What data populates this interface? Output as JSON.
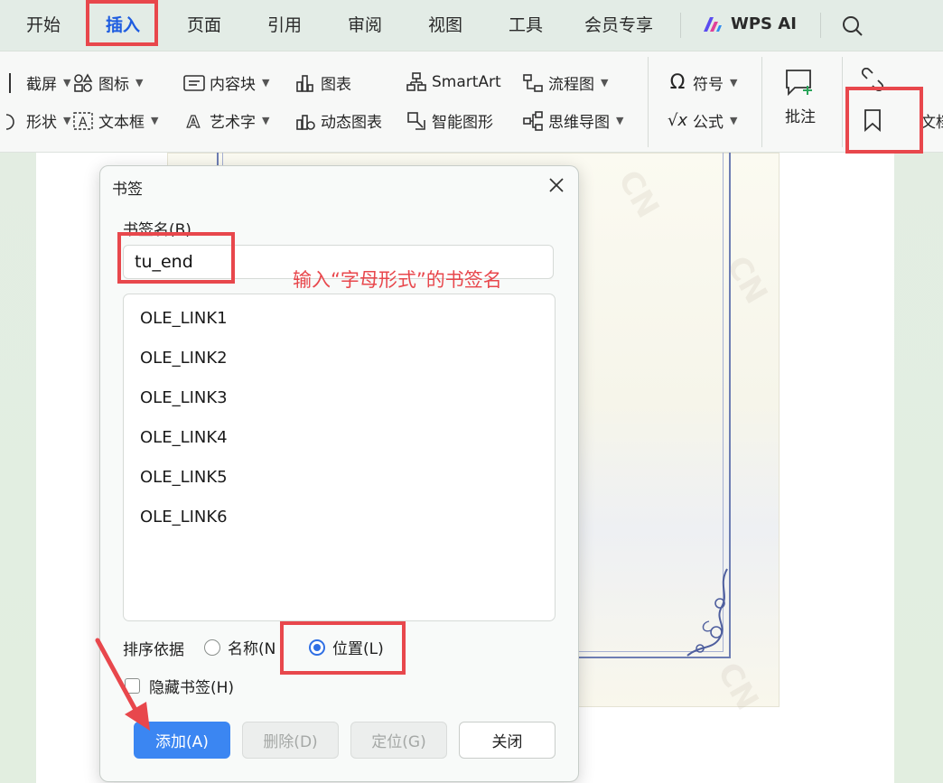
{
  "menubar": {
    "tabs": [
      "开始",
      "插入",
      "页面",
      "引用",
      "审阅",
      "视图",
      "工具",
      "会员专享"
    ],
    "active_tab": "插入",
    "wps_ai": "WPS AI"
  },
  "ribbon": {
    "row1": {
      "screenshot": "截屏",
      "icons": "图标",
      "content_block": "内容块",
      "chart": "图表",
      "smartart": "SmartArt",
      "flowchart": "流程图",
      "symbol": "符号"
    },
    "row2": {
      "shapes": "形状",
      "textbox": "文本框",
      "wordart": "艺术字",
      "dynamic_chart": "动态图表",
      "smart_graphic": "智能图形",
      "mindmap": "思维导图",
      "formula": "公式"
    },
    "comment": "批注",
    "doc_partial": "文档"
  },
  "dialog": {
    "title": "书签",
    "name_label": "书签名(B)",
    "name_value": "tu_end",
    "bookmarks": [
      "OLE_LINK1",
      "OLE_LINK2",
      "OLE_LINK3",
      "OLE_LINK4",
      "OLE_LINK5",
      "OLE_LINK6"
    ],
    "sort_label": "排序依据",
    "sort_by_name": "名称(N",
    "sort_by_position": "位置(L)",
    "selected_sort": "位置(L)",
    "hide_bookmarks": "隐藏书签(H)",
    "buttons": {
      "add": "添加(A)",
      "delete": "删除(D)",
      "goto": "定位(G)",
      "close": "关闭"
    }
  },
  "annotation": {
    "hint": "输入“字母形式”的书签名",
    "color": "#e8474c"
  },
  "colors": {
    "accent": "#1f5de0",
    "primary_button": "#3b86f2"
  }
}
